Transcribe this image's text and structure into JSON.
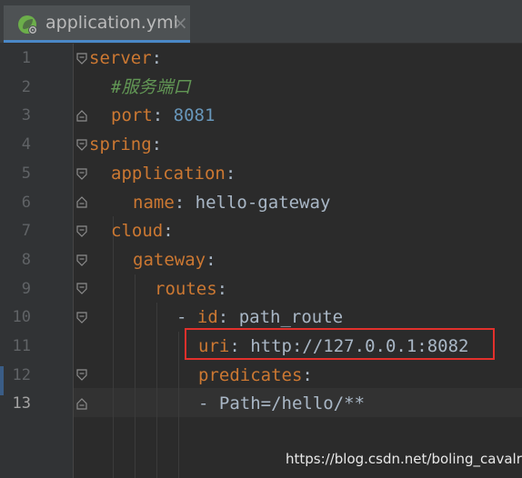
{
  "tab": {
    "title": "application.yml",
    "close": "×",
    "icon": "spring-leaf-icon"
  },
  "lines": [
    {
      "num": "1"
    },
    {
      "num": "2"
    },
    {
      "num": "3"
    },
    {
      "num": "4"
    },
    {
      "num": "5"
    },
    {
      "num": "6"
    },
    {
      "num": "7"
    },
    {
      "num": "8"
    },
    {
      "num": "9"
    },
    {
      "num": "10"
    },
    {
      "num": "11"
    },
    {
      "num": "12"
    },
    {
      "num": "13"
    }
  ],
  "code": {
    "l1_key": "server",
    "l2_comment": "#服务端口",
    "l3_key": "port",
    "l3_value": "8081",
    "l4_key": "spring",
    "l5_key": "application",
    "l6_key": "name",
    "l6_value": "hello-gateway",
    "l7_key": "cloud",
    "l8_key": "gateway",
    "l9_key": "routes",
    "l10_dash": "- ",
    "l10_key": "id",
    "l10_value": "path_route",
    "l11_key": "uri",
    "l11_value": "http://127.0.0.1:8082",
    "l12_key": "predicates",
    "l13_value": "- Path=/hello/**",
    "colon": ":"
  },
  "watermark": "https://blog.csdn.net/boling_cavalry",
  "colors": {
    "keyword": "#cc7832",
    "number": "#6897bb",
    "comment": "#629755",
    "text": "#a9b7c6",
    "highlight_border": "#e2302c"
  }
}
